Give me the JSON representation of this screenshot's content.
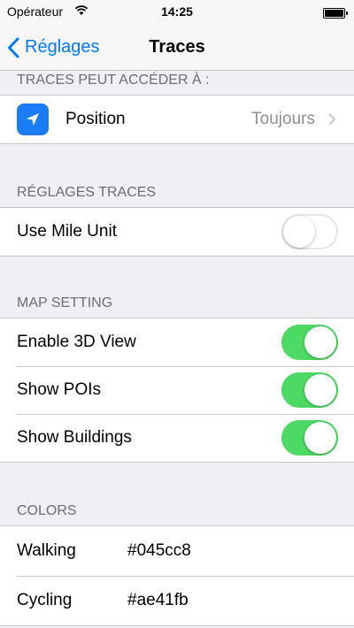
{
  "status": {
    "carrier": "Opérateur",
    "time": "14:25"
  },
  "nav": {
    "back_label": "Réglages",
    "title": "Traces"
  },
  "sections": {
    "access": {
      "header": "TRACES PEUT ACCÉDER À :",
      "position_label": "Position",
      "position_value": "Toujours"
    },
    "settings": {
      "header": "RÉGLAGES TRACES",
      "mile_label": "Use Mile Unit",
      "mile_on": false
    },
    "map": {
      "header": "MAP SETTING",
      "items": [
        {
          "label": "Enable 3D View",
          "on": true
        },
        {
          "label": "Show POIs",
          "on": true
        },
        {
          "label": "Show Buildings",
          "on": true
        }
      ]
    },
    "colors": {
      "header": "COLORS",
      "items": [
        {
          "label": "Walking",
          "value": "#045cc8"
        },
        {
          "label": "Cycling",
          "value": "#ae41fb"
        }
      ]
    }
  },
  "theme": {
    "accent": "#007aff",
    "toggle_on": "#4cd964",
    "location_icon_bg": "#1a7cf6"
  }
}
